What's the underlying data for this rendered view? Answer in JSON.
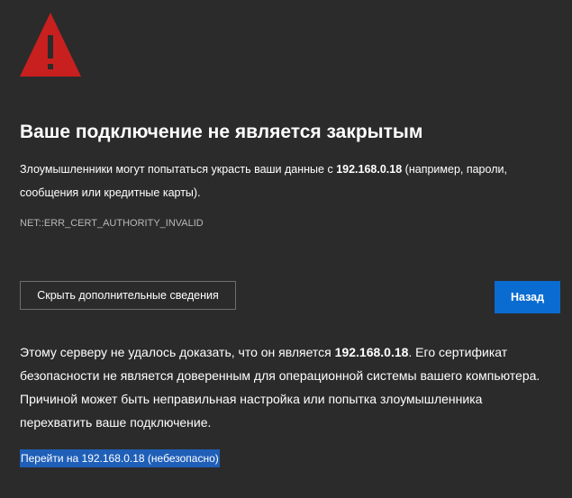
{
  "icons": {
    "warning": "warning-triangle-icon"
  },
  "colors": {
    "background": "#2b2b2b",
    "warning_red": "#c8201e",
    "primary_button": "#0a6cd1",
    "link_highlight": "#1f5fb8",
    "error_code_text": "#b8b8b8"
  },
  "heading": {
    "title": "Ваше подключение не является закрытым"
  },
  "description": {
    "before_host": "Злоумышленники могут попытаться украсть ваши данные с ",
    "host": "192.168.0.18",
    "after_host": " (например, пароли, сообщения или кредитные карты)."
  },
  "error_code": "NET::ERR_CERT_AUTHORITY_INVALID",
  "buttons": {
    "details_label": "Скрыть дополнительные сведения",
    "back_label": "Назад"
  },
  "details": {
    "before_host": "Этому серверу не удалось доказать, что он является ",
    "host": "192.168.0.18",
    "after_host": ". Его сертификат безопасности не является доверенным для операционной системы вашего компьютера. Причиной может быть неправильная настройка или попытка злоумышленника перехватить ваше подключение."
  },
  "proceed_link": "Перейти на 192.168.0.18 (небезопасно)"
}
